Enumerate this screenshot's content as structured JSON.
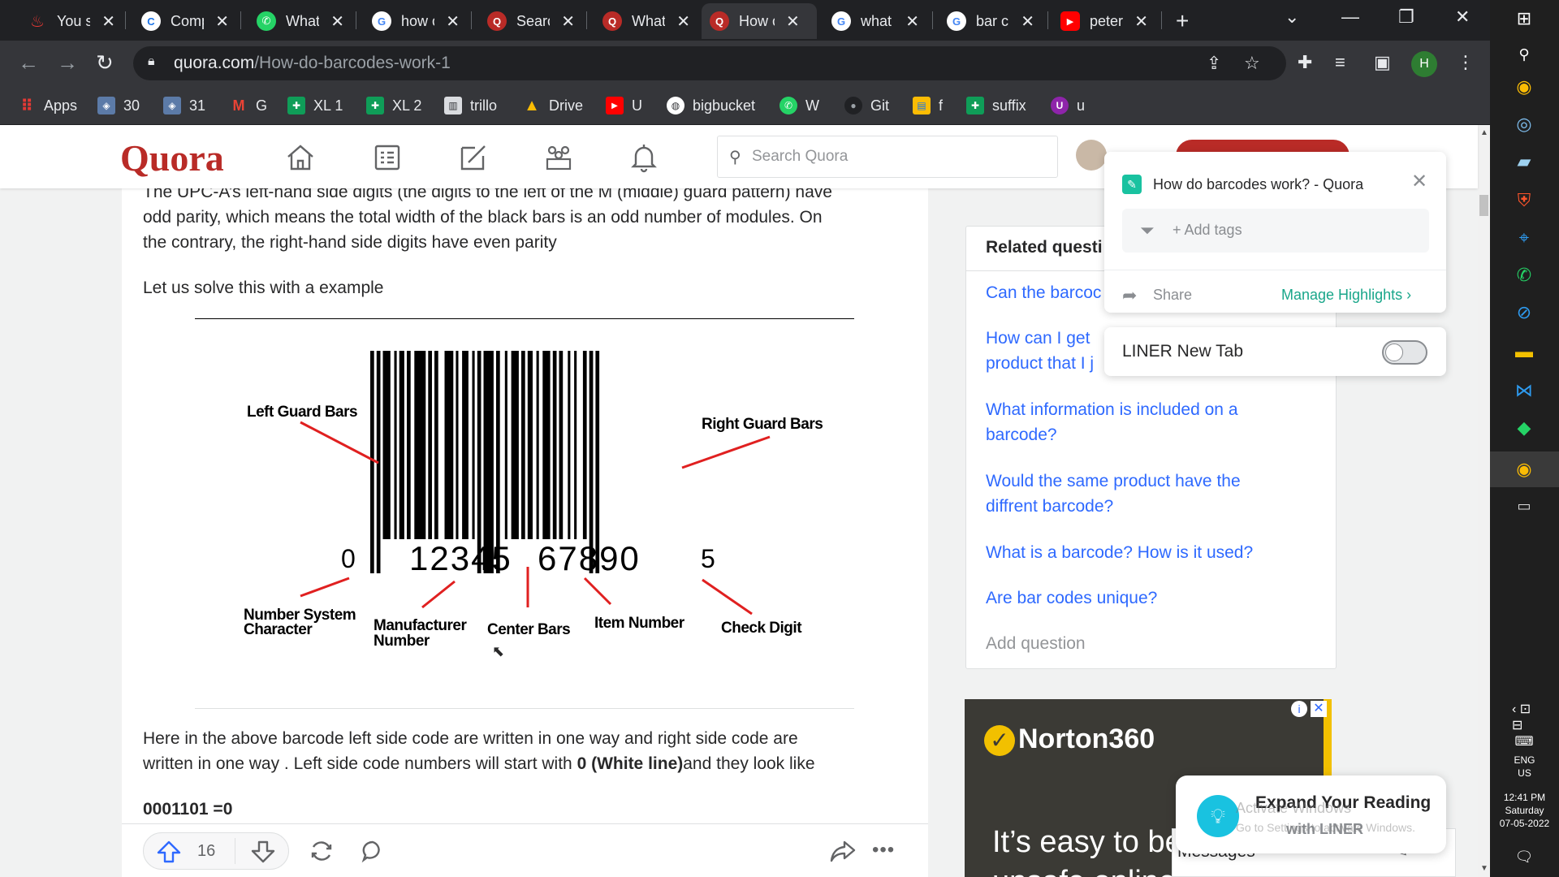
{
  "browser": {
    "tabs": [
      {
        "title": "You s",
        "icon": "flame-icon",
        "color": "#e53935"
      },
      {
        "title": "Comp",
        "icon": "c-logo-icon",
        "color": "#1a73e8"
      },
      {
        "title": "What",
        "icon": "whatsapp-icon",
        "color": "#25d366"
      },
      {
        "title": "how c",
        "icon": "google-icon",
        "color": "#ffffff"
      },
      {
        "title": "Searc",
        "icon": "quora-icon",
        "color": "#b92b27"
      },
      {
        "title": "What",
        "icon": "quora-icon",
        "color": "#b92b27"
      },
      {
        "title": "How c",
        "icon": "quora-icon",
        "color": "#b92b27",
        "active": true
      },
      {
        "title": "what",
        "icon": "google-icon",
        "color": "#ffffff"
      },
      {
        "title": "bar c",
        "icon": "google-icon",
        "color": "#ffffff"
      },
      {
        "title": "peter",
        "icon": "youtube-icon",
        "color": "#ff0000"
      }
    ],
    "url_domain": "quora.com",
    "url_path": "/How-do-barcodes-work-1",
    "profile_initial": "H",
    "bookmarks": [
      {
        "label": "Apps",
        "icon": "apps-grid-icon"
      },
      {
        "label": "30",
        "icon": "bookmark-site-icon"
      },
      {
        "label": "31",
        "icon": "bookmark-site-icon"
      },
      {
        "label": "G",
        "icon": "gmail-icon"
      },
      {
        "label": "XL 1",
        "icon": "sheets-icon"
      },
      {
        "label": "XL 2",
        "icon": "sheets-icon"
      },
      {
        "label": "trillo",
        "icon": "trello-icon"
      },
      {
        "label": "Drive",
        "icon": "drive-icon"
      },
      {
        "label": "U",
        "icon": "youtube-icon"
      },
      {
        "label": "bigbucket",
        "icon": "globe-icon"
      },
      {
        "label": "W",
        "icon": "whatsapp-icon"
      },
      {
        "label": "Git",
        "icon": "github-icon"
      },
      {
        "label": "f",
        "icon": "folder-icon"
      },
      {
        "label": "suffix",
        "icon": "sheets-icon"
      },
      {
        "label": "u",
        "icon": "u-logo-icon"
      }
    ]
  },
  "quora": {
    "logo": "Quora",
    "search_placeholder": "Search Quora"
  },
  "answer": {
    "para1_line1": "The UPC-A’s left-hand side digits (the digits to the left of the M (middle) guard pattern) have",
    "para1_line2": "odd parity, which means the total width of the black bars is an odd number of modules. On",
    "para1_line3": "the contrary, the right-hand side digits have even parity",
    "para2": "Let us solve this with a example",
    "para3_line1": "Here in the above barcode left side code are written in one way and right side code are",
    "para3_line2_a": "written in one way . Left side code numbers will start with ",
    "para3_line2_b": "0 (White line)",
    "para3_line2_c": "and they look like",
    "code_line": "0001101 =0",
    "upvotes": "16"
  },
  "figure": {
    "left_guard": "Left Guard Bars",
    "right_guard": "Right Guard Bars",
    "digit_system": "0",
    "digits_left": "12345",
    "digits_right": "67890",
    "digit_check": "5",
    "number_system_l1": "Number System",
    "number_system_l2": "Character",
    "manufacturer_l1": "Manufacturer",
    "manufacturer_l2": "Number",
    "center_bars": "Center Bars",
    "item_number": "Item Number",
    "check_digit": "Check Digit"
  },
  "sidebar": {
    "header": "Related questi",
    "questions": [
      "Can the barcoc",
      "How can I get",
      "product that I j",
      "What information is included on a",
      "barcode?",
      "Would the same product have the",
      "diffrent barcode?",
      "What is a barcode? How is it used?",
      "Are bar codes unique?"
    ],
    "add_question": "Add question"
  },
  "ad": {
    "brand": "Norton360",
    "tagline": "It’s easy to be",
    "tagline2": "unsafe online"
  },
  "liner": {
    "page_title": "How do barcodes work? - Quora",
    "add_tags": "+ Add tags",
    "share": "Share",
    "manage": "Manage Highlights",
    "newtab_label": "LINER New Tab",
    "expand_title": "Expand Your Reading",
    "expand_sub": "with LINER",
    "watermark1": "Activate Windows",
    "watermark2": "Go to Settings to activate Windows."
  },
  "messages": {
    "label": "Messages"
  },
  "taskbar": {
    "lang1": "ENG",
    "lang2": "US",
    "time": "12:41 PM",
    "day": "Saturday",
    "date": "07-05-2022"
  }
}
